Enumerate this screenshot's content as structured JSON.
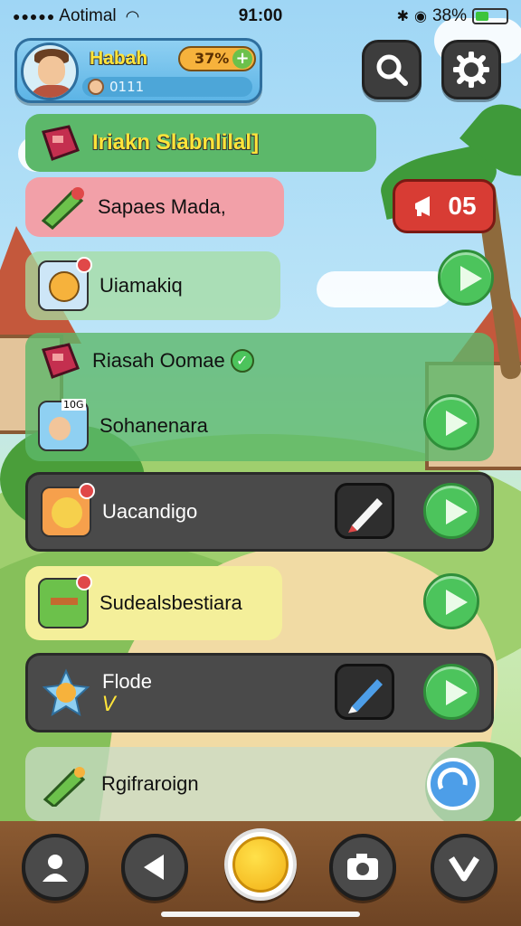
{
  "status_bar": {
    "carrier": "Aotimal",
    "time": "91:00",
    "battery": "38%"
  },
  "profile": {
    "name": "Habah",
    "level": "37%",
    "coins": "0111"
  },
  "header_row": {
    "label": "Iriakn Slabnlilal]"
  },
  "rows": [
    {
      "label": "Sapaes Mada,"
    },
    {
      "label": "Uiamakiq"
    },
    {
      "label": "Riasah Oomae"
    },
    {
      "label": "Sohanenara",
      "icon_caption": "10G"
    },
    {
      "label": "Uacandigo"
    },
    {
      "label": "Sudealsbestiara"
    },
    {
      "label": "Flode",
      "sub": "V"
    },
    {
      "label": "Rgifraroign"
    }
  ],
  "counter": {
    "value": "05"
  },
  "colors": {
    "green_panel": "#5cb86a",
    "pink_panel": "#f2a0a8",
    "dark_panel": "#4a4a4a",
    "yellow_panel": "#f4ef9a",
    "play_green": "#4cc45c",
    "counter_red": "#d83c34"
  },
  "icons": {
    "search": "search-icon",
    "settings": "gear-icon",
    "profile": "user-icon",
    "back": "left-triangle-icon",
    "home": "gold-circle-icon",
    "camera": "camera-icon",
    "more": "chevron-down-icon"
  }
}
